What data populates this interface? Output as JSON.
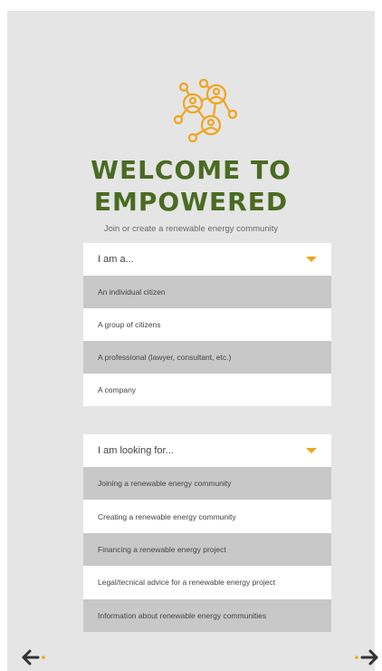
{
  "header": {
    "title_line1": "WELCOME TO",
    "title_line2": "EMPOWERED",
    "subtitle": "Join or create a renewable energy community"
  },
  "logo": {
    "icon": "community-network-icon",
    "color": "#f0a51e"
  },
  "role_dropdown": {
    "label": "I am a...",
    "options": [
      "An individual citizen",
      "A group of citizens",
      "A professional (lawyer, consultant, etc.)",
      "A company"
    ]
  },
  "goal_dropdown": {
    "label": "I am looking for...",
    "options": [
      "Joining a renewable energy community",
      "Creating a renewable energy community",
      "Financing a renewable energy project",
      "Legal/tecnical advice for a renewable energy project",
      "Information about renewable energy communities"
    ]
  },
  "nav": {
    "back_icon": "arrow-left-icon",
    "next_icon": "arrow-right-icon"
  },
  "colors": {
    "title": "#4a6b22",
    "accent": "#f0a51e",
    "background": "#e5e5e5",
    "option_grey": "#c8c8c8"
  }
}
